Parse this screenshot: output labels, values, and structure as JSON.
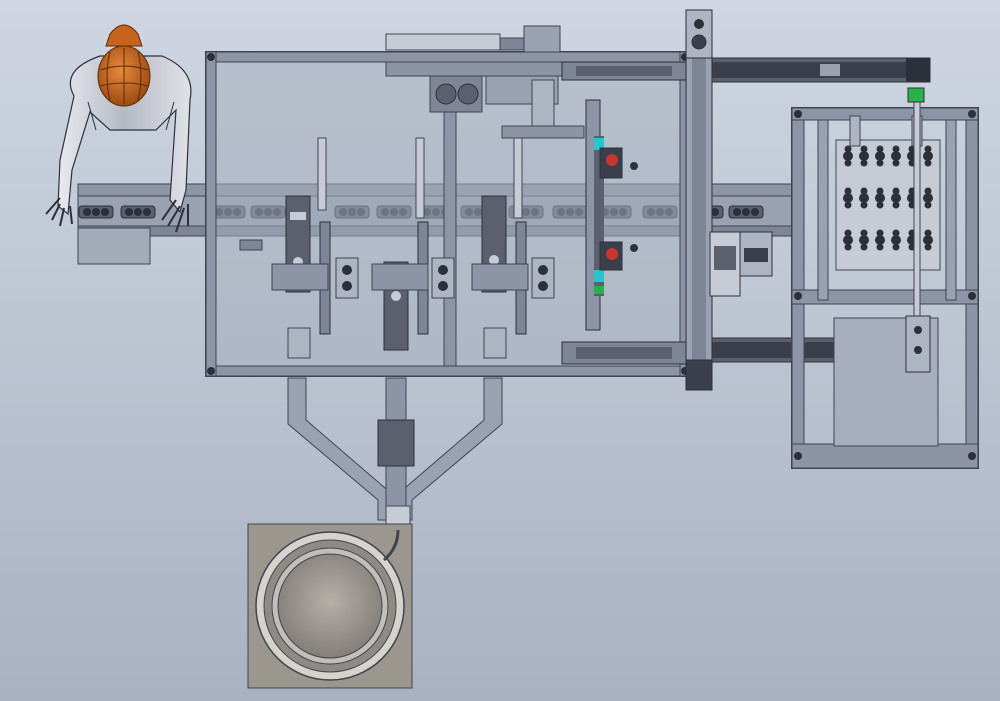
{
  "scene": {
    "background_top": "#cfd6e2",
    "background_bottom": "#a9b2c2",
    "frame_color": "#8c94a6",
    "panel_color": "#a6aebd",
    "edge_color": "#3e4452",
    "dark_part_color": "#2c303a",
    "accent_cyan": "#27c6cf",
    "accent_green": "#29b24a",
    "accent_red": "#c8372f",
    "operator_head_color": "#c6631c",
    "operator_body_color": "#c9ccd6"
  }
}
